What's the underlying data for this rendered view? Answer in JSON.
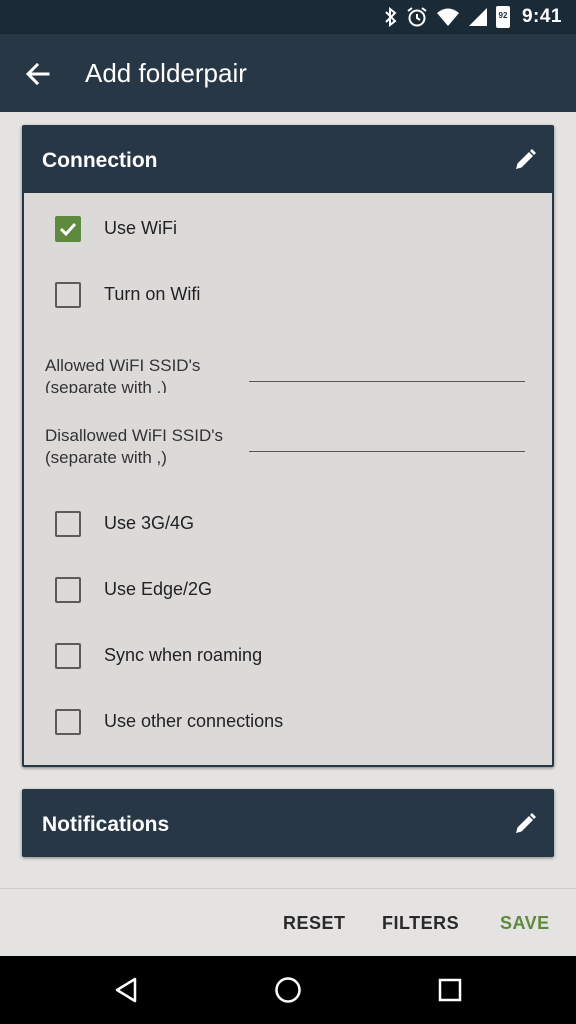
{
  "status_bar": {
    "time": "9:41",
    "battery_level": "92"
  },
  "app_bar": {
    "title": "Add folderpair"
  },
  "connection_card": {
    "title": "Connection",
    "options": [
      {
        "label": "Use WiFi",
        "checked": true
      },
      {
        "label": "Turn on Wifi",
        "checked": false
      }
    ],
    "allowed_ssid": {
      "label": "Allowed WiFI SSID's (separate with ,)",
      "value": ""
    },
    "disallowed_ssid": {
      "label": "Disallowed WiFI SSID's (separate with ,)",
      "value": ""
    },
    "network_options": [
      {
        "label": "Use 3G/4G",
        "checked": false
      },
      {
        "label": "Use Edge/2G",
        "checked": false
      },
      {
        "label": "Sync when roaming",
        "checked": false
      },
      {
        "label": "Use other connections",
        "checked": false
      }
    ]
  },
  "notifications_card": {
    "title": "Notifications"
  },
  "actions": {
    "reset": "RESET",
    "filters": "FILTERS",
    "save": "SAVE"
  },
  "colors": {
    "header": "#273746",
    "status_bar": "#1b2a37",
    "accent_green": "#5e8a3e"
  },
  "icons": {
    "back": "arrow-left-icon",
    "edit": "pencil-icon",
    "nav_back": "triangle-back-icon",
    "nav_home": "circle-home-icon",
    "nav_recent": "square-recent-icon"
  }
}
